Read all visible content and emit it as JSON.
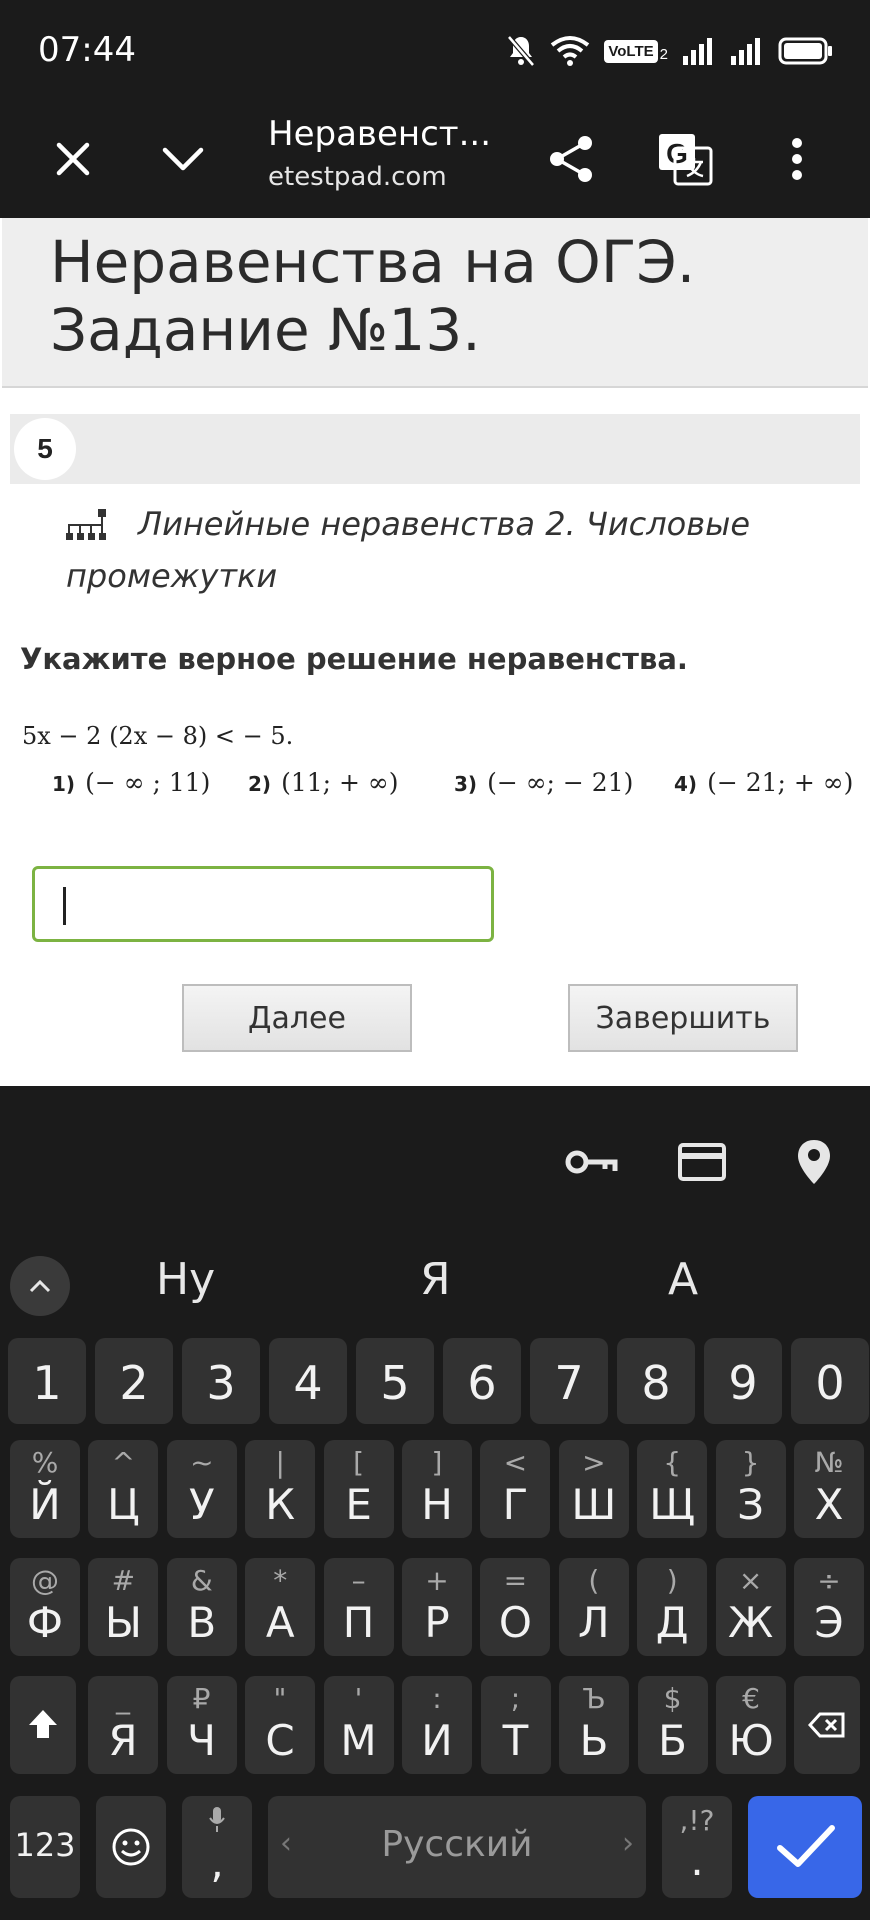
{
  "status_bar": {
    "time": "07:44",
    "volte_label": "VoLTE",
    "sim_index": "2"
  },
  "browser": {
    "tab_title": "Неравенст...",
    "url": "etestpad.com"
  },
  "page": {
    "title_line1": "Неравенства на ОГЭ.",
    "title_line2": "Задание №13.",
    "question_number": "5",
    "topic": "Линейные неравенства 2. Числовые промежутки",
    "prompt": "Укажите верное решение неравенства.",
    "inequality": "5x − 2 (2x − 8) < − 5.",
    "options": [
      {
        "num": "1)",
        "text": "(− ∞ ; 11)"
      },
      {
        "num": "2)",
        "text": "(11; + ∞)"
      },
      {
        "num": "3)",
        "text": "(− ∞; − 21)"
      },
      {
        "num": "4)",
        "text": "(− 21; + ∞)"
      }
    ],
    "answer_value": "",
    "next_button": "Далее",
    "finish_button": "Завершить"
  },
  "keyboard": {
    "suggestions": [
      "Ну",
      "Я",
      "А"
    ],
    "number_row": [
      "1",
      "2",
      "3",
      "4",
      "5",
      "6",
      "7",
      "8",
      "9",
      "0"
    ],
    "row1": [
      {
        "main": "Й",
        "sub": "%"
      },
      {
        "main": "Ц",
        "sub": "^"
      },
      {
        "main": "У",
        "sub": "~"
      },
      {
        "main": "К",
        "sub": "|"
      },
      {
        "main": "Е",
        "sub": "["
      },
      {
        "main": "Н",
        "sub": "]"
      },
      {
        "main": "Г",
        "sub": "<"
      },
      {
        "main": "Ш",
        "sub": ">"
      },
      {
        "main": "Щ",
        "sub": "{"
      },
      {
        "main": "З",
        "sub": "}"
      },
      {
        "main": "Х",
        "sub": "№"
      }
    ],
    "row2": [
      {
        "main": "Ф",
        "sub": "@"
      },
      {
        "main": "Ы",
        "sub": "#"
      },
      {
        "main": "В",
        "sub": "&"
      },
      {
        "main": "А",
        "sub": "*"
      },
      {
        "main": "П",
        "sub": "–"
      },
      {
        "main": "Р",
        "sub": "+"
      },
      {
        "main": "О",
        "sub": "="
      },
      {
        "main": "Л",
        "sub": "("
      },
      {
        "main": "Д",
        "sub": ")"
      },
      {
        "main": "Ж",
        "sub": "×"
      },
      {
        "main": "Э",
        "sub": "÷"
      }
    ],
    "row3": [
      {
        "main": "Я",
        "sub": "_"
      },
      {
        "main": "Ч",
        "sub": "₽"
      },
      {
        "main": "С",
        "sub": "\""
      },
      {
        "main": "М",
        "sub": "'"
      },
      {
        "main": "И",
        "sub": ":"
      },
      {
        "main": "Т",
        "sub": ";"
      },
      {
        "main": "Ь",
        "sub": "Ъ"
      },
      {
        "main": "Б",
        "sub": "$"
      },
      {
        "main": "Ю",
        "sub": "€"
      }
    ],
    "symbols_key": "123",
    "comma_key": ",",
    "space_label": "Русский",
    "period_key": ".",
    "period_sub": ",!?",
    "colors": {
      "background": "#1b1b1b",
      "key": "#323232",
      "enter": "#3867e8",
      "input_border": "#7cb342"
    }
  }
}
